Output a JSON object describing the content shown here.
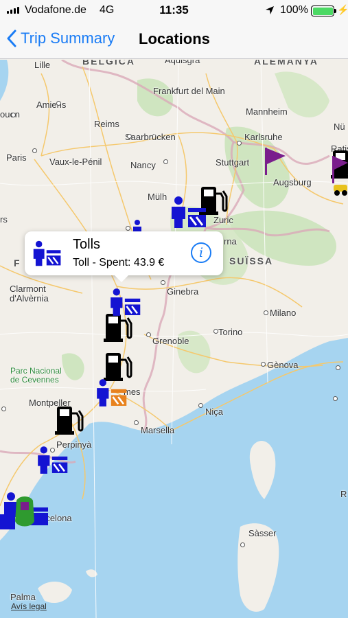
{
  "status_bar": {
    "carrier": "Vodafone.de",
    "network": "4G",
    "time": "11:35",
    "battery_percent": "100%"
  },
  "nav": {
    "back_label": "Trip Summary",
    "title": "Locations"
  },
  "map": {
    "labels": {
      "belgica": "BELGICA",
      "alemanya": "ALEMANYA",
      "aquisgra": "Aquisgrà",
      "lille": "Lille",
      "frankfurt": "Frankfurt del Main",
      "mannheim": "Mannheim",
      "nu": "Nü",
      "amiens": "Amiens",
      "rouen": "ouen",
      "reims": "Reims",
      "karlsruhe": "Karlsruhe",
      "ratis": "Ratis",
      "saarbrucken": "Saarbrücken",
      "paris": "Paris",
      "vaux": "Vaux-le-Pénil",
      "nancy": "Nancy",
      "stuttgart": "Stuttgart",
      "augsburg": "Augsburg",
      "mulh": "Mülh",
      "zuric": "Zuric",
      "rs": "rs",
      "rna": "rna",
      "suissa": "SUÏSSA",
      "f": "F",
      "clermont": "Clarmont\nd'Alvèrnia",
      "ginebra": "Ginebra",
      "milano": "Milano",
      "grenoble": "Grenoble",
      "torino": "Torino",
      "genova": "Gènova",
      "park": "Parc Nacional\nde Cevennes",
      "montpeller": "Montpeller",
      "nimes": "mes",
      "nica": "Niça",
      "marsella": "Marsella",
      "perpinya": "Perpinyà",
      "barcelona": "rcelona",
      "sasser": "Sàsser",
      "palma": "Palma",
      "r": "R"
    },
    "legal": "Avís legal"
  },
  "callout": {
    "title": "Tolls",
    "subtitle": "Toll - Spent: 43.9 €"
  },
  "colors": {
    "toll_blue": "#1414d2",
    "fuel_black": "#000000",
    "flag_purple": "#7a1e8c",
    "accent": "#1a7cf5",
    "sea": "#a6d4f0"
  }
}
